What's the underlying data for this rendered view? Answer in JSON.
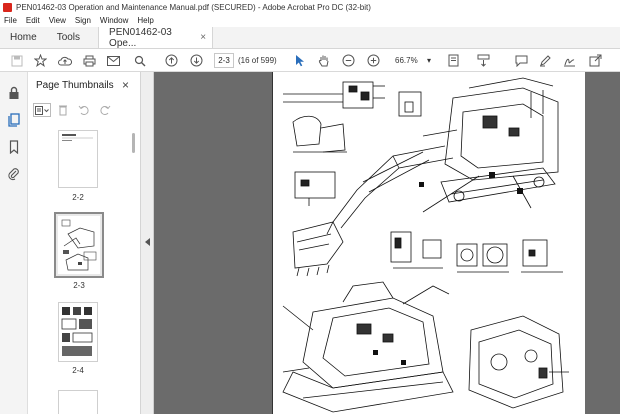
{
  "window": {
    "title": "PEN01462-03 Operation and Maintenance Manual.pdf (SECURED) - Adobe Acrobat Pro DC (32-bit)"
  },
  "menu": [
    "File",
    "Edit",
    "View",
    "Sign",
    "Window",
    "Help"
  ],
  "tabs": {
    "home": "Home",
    "tools": "Tools",
    "document": "PEN01462-03 Ope...",
    "close": "×"
  },
  "toolbar": {
    "page_input": "2-3",
    "page_count": "(16 of 599)",
    "zoom": "66.7%",
    "zoom_arrow": "▾"
  },
  "panel": {
    "title": "Page Thumbnails",
    "close": "×",
    "thumbnails": [
      {
        "label": "2-2"
      },
      {
        "label": "2-3"
      },
      {
        "label": "2-4"
      }
    ]
  },
  "colors": {
    "accent": "#d9261c",
    "viewer_bg": "#565656",
    "selected_thumb_border": "#8a8a8a"
  }
}
